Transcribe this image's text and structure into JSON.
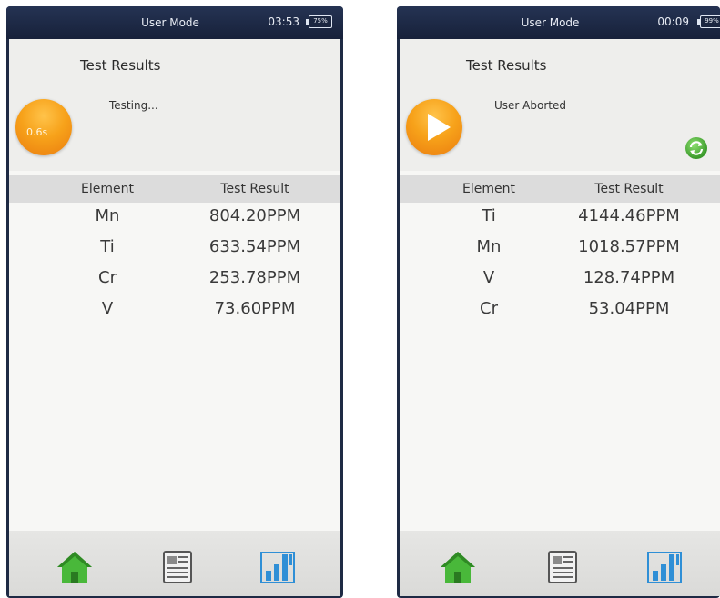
{
  "screens": [
    {
      "status_bar": {
        "mode": "User Mode",
        "time": "03:53",
        "battery": "75%"
      },
      "title": "Test Results",
      "status_indicator": {
        "type": "timer",
        "value": "0.6s"
      },
      "status_text": "Testing...",
      "table": {
        "headers": [
          "Element",
          "Test Result"
        ],
        "rows": [
          {
            "element": "Mn",
            "result": "804.20PPM"
          },
          {
            "element": "Ti",
            "result": "633.54PPM"
          },
          {
            "element": "Cr",
            "result": "253.78PPM"
          },
          {
            "element": "V",
            "result": "73.60PPM"
          }
        ]
      },
      "nav": [
        "home-icon",
        "report-icon",
        "chart-icon"
      ]
    },
    {
      "status_bar": {
        "mode": "User Mode",
        "time": "00:09",
        "battery": "99%"
      },
      "title": "Test Results",
      "status_indicator": {
        "type": "play",
        "value": ""
      },
      "status_text": "User Aborted",
      "refresh_icon": "refresh-icon",
      "table": {
        "headers": [
          "Element",
          "Test Result"
        ],
        "rows": [
          {
            "element": "Ti",
            "result": "4144.46PPM"
          },
          {
            "element": "Mn",
            "result": "1018.57PPM"
          },
          {
            "element": "V",
            "result": "128.74PPM"
          },
          {
            "element": "Cr",
            "result": "53.04PPM"
          }
        ]
      },
      "nav": [
        "home-icon",
        "report-icon",
        "chart-icon"
      ]
    }
  ],
  "colors": {
    "frame": "#1e2a44",
    "accent_orange": "#f7a21a",
    "nav_green": "#49b83a",
    "nav_blue": "#2f8fd6"
  }
}
